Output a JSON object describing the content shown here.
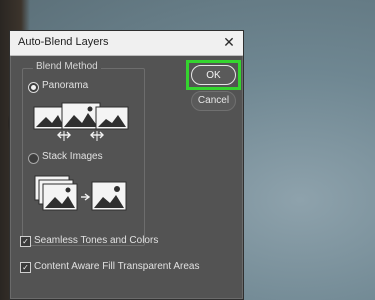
{
  "dialog": {
    "title": "Auto-Blend Layers",
    "close_glyph": "✕",
    "blend_method_label": "Blend Method",
    "options": [
      {
        "label": "Panorama",
        "selected": true
      },
      {
        "label": "Stack Images",
        "selected": false
      }
    ],
    "checkboxes": [
      {
        "label": "Seamless Tones and Colors",
        "checked": true
      },
      {
        "label": "Content Aware Fill Transparent Areas",
        "checked": true
      }
    ],
    "ok_label": "OK",
    "cancel_label": "Cancel",
    "check_glyph": "✓"
  },
  "colors": {
    "dialog_bg": "#535353",
    "highlight": "#35d42f"
  },
  "icons": [
    "panorama-preview-icon",
    "stack-images-preview-icon",
    "close-icon"
  ]
}
